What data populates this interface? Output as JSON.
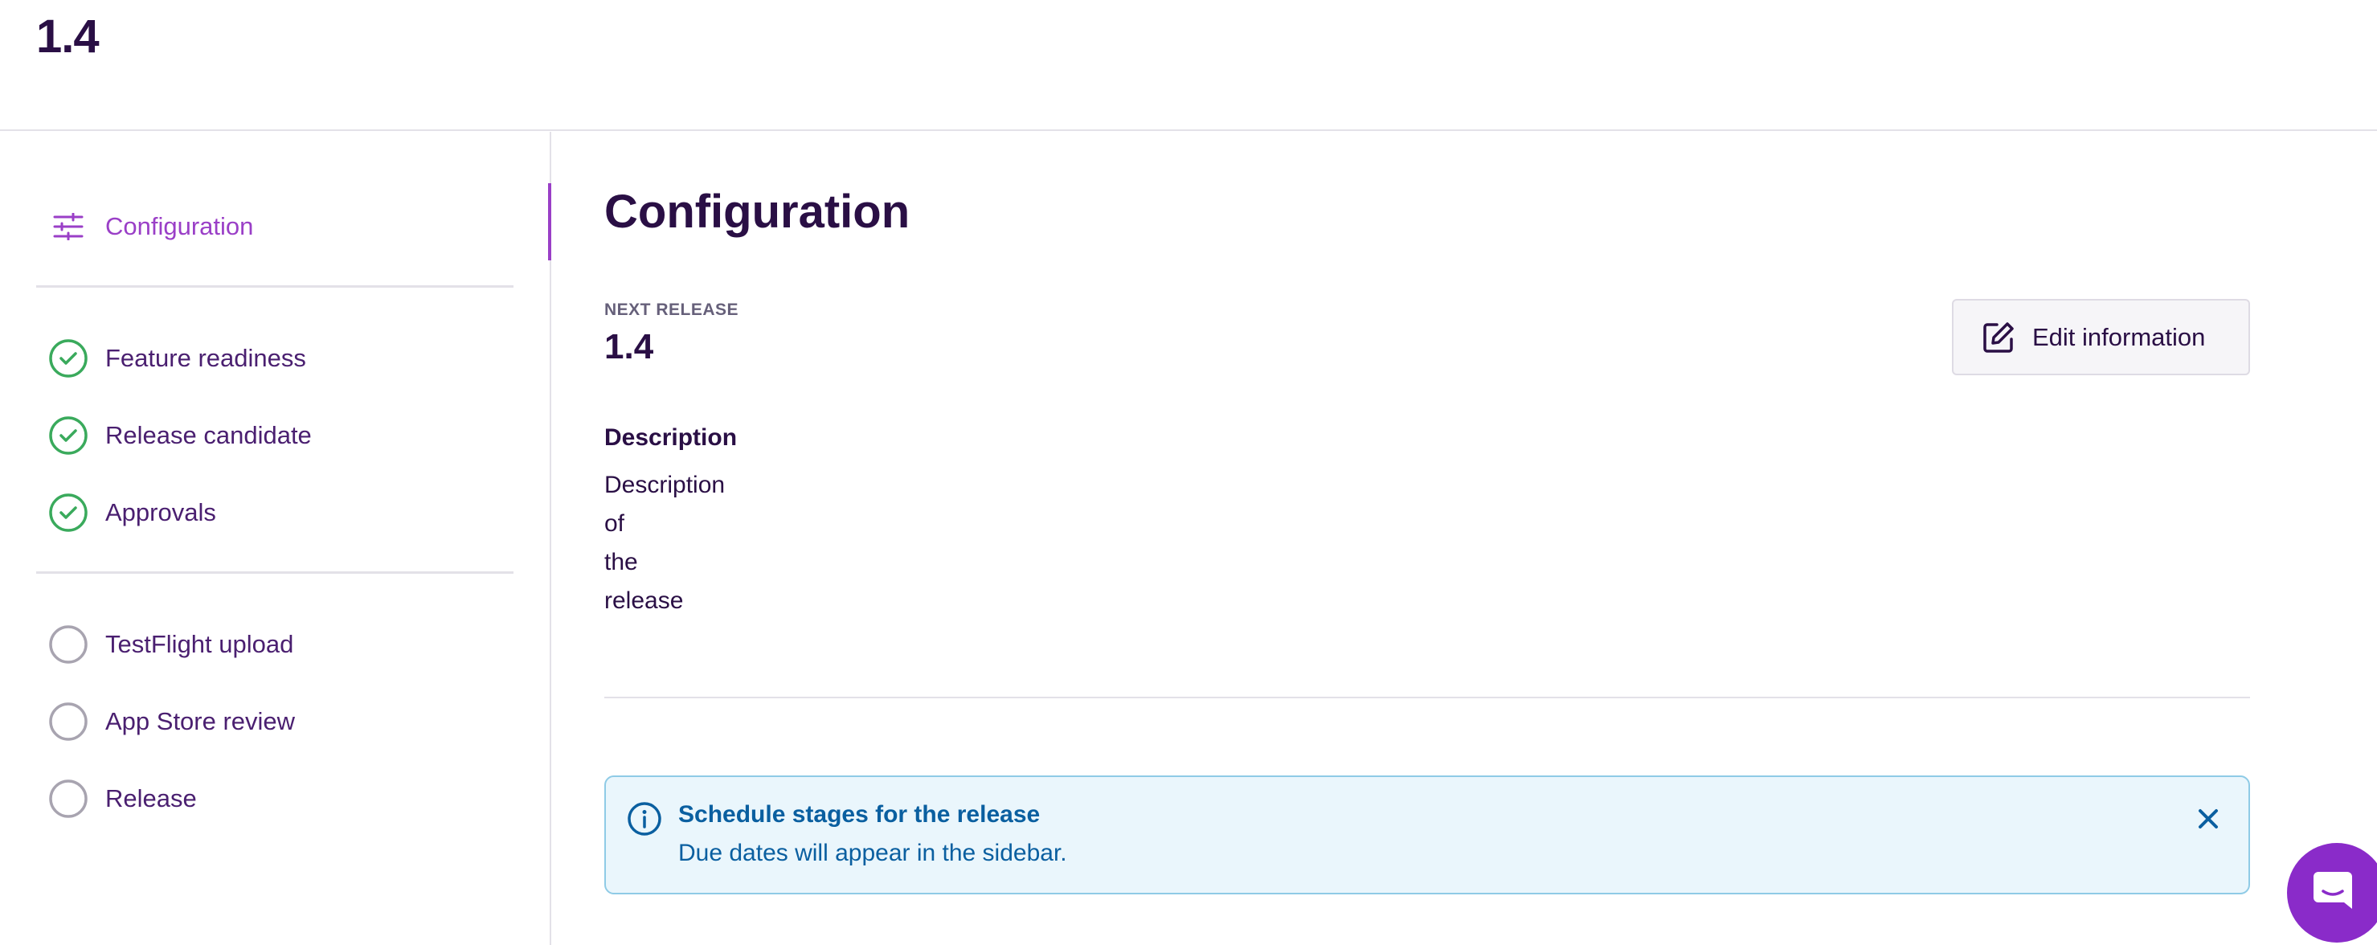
{
  "header": {
    "title": "1.4"
  },
  "sidebar": {
    "items": [
      {
        "label": "Configuration",
        "icon": "sliders-icon",
        "state": "active"
      },
      {
        "label": "Feature readiness",
        "icon": "check-circle-icon",
        "state": "done"
      },
      {
        "label": "Release candidate",
        "icon": "check-circle-icon",
        "state": "done"
      },
      {
        "label": "Approvals",
        "icon": "check-circle-icon",
        "state": "done"
      },
      {
        "label": "TestFlight upload",
        "icon": "empty-circle-icon",
        "state": "pending"
      },
      {
        "label": "App Store review",
        "icon": "empty-circle-icon",
        "state": "pending"
      },
      {
        "label": "Release",
        "icon": "empty-circle-icon",
        "state": "pending"
      }
    ]
  },
  "main": {
    "title": "Configuration",
    "next_release_label": "NEXT RELEASE",
    "version": "1.4",
    "description_label": "Description",
    "description": "Description of the release",
    "edit_button": {
      "label": "Edit information",
      "icon": "edit-icon"
    }
  },
  "banner": {
    "icon": "info-icon",
    "title": "Schedule stages for the release",
    "subtitle": "Due dates will appear in the sidebar.",
    "close_icon": "close-icon"
  },
  "chat": {
    "icon": "chat-icon"
  },
  "colors": {
    "primary_text": "#2a0f45",
    "accent": "#9a3fc7",
    "success": "#3aaa5c",
    "pending": "#a8a4b0",
    "info_bg": "#eaf6fc",
    "info_text": "#0a5fa0",
    "launcher": "#8a2bc9"
  }
}
